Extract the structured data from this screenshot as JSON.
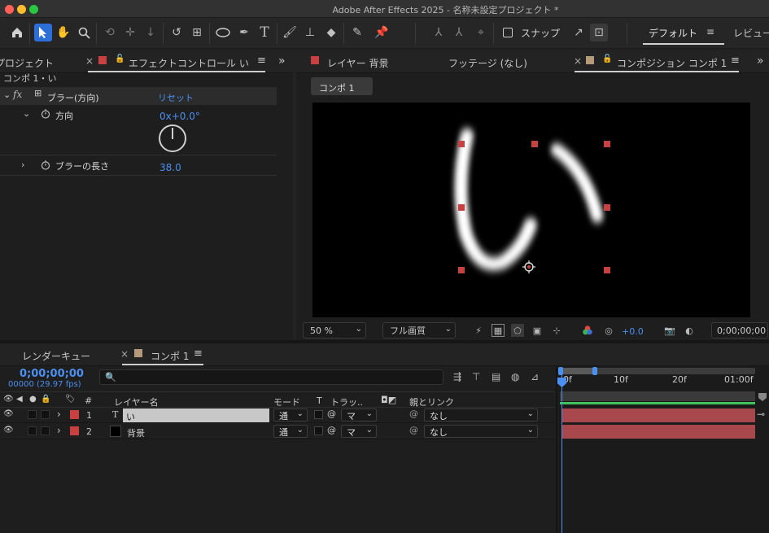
{
  "window": {
    "title": "Adobe After Effects 2025 - 名称未設定プロジェクト *"
  },
  "toolbar": {
    "snap_label": "スナップ",
    "workspace_default": "デフォルト",
    "workspace_review": "レビュー",
    "menu_icon": "≡"
  },
  "effects_panel": {
    "project_tab": "プロジェクト",
    "tab_label": "エフェクトコントロール い",
    "breadcrumb": "コンポ 1・い",
    "effect_name": "ブラー(方向)",
    "reset_label": "リセット",
    "direction_label": "方向",
    "direction_value": "0x+0.0°",
    "blur_length_label": "ブラーの長さ",
    "blur_length_value": "38.0"
  },
  "viewer": {
    "layer_tab": "レイヤー 背景",
    "footage_tab": "フッテージ (なし)",
    "comp_tab": "コンポジション コンポ 1",
    "comp_button": "コンポ 1",
    "text_glyph": "い",
    "zoom": "50 %",
    "quality": "フル画質",
    "exposure": "+0.0",
    "timecode": "0;00;00;00"
  },
  "timeline": {
    "render_queue_tab": "レンダーキュー",
    "comp_tab": "コンポ 1",
    "timecode": "0;00;00;00",
    "frame_info": "00000 (29.97 fps)",
    "search_placeholder": "",
    "columns": {
      "number": "#",
      "layer_name": "レイヤー名",
      "mode": "モード",
      "t": "T",
      "track": "トラッ..",
      "parent": "親とリンク"
    },
    "ruler": [
      "0f",
      "10f",
      "20f",
      "01:00f"
    ],
    "layers": [
      {
        "index": "1",
        "name": "い",
        "type_icon": "T",
        "mode": "通",
        "track": "マ",
        "parent": "なし"
      },
      {
        "index": "2",
        "name": "背景",
        "type_icon": "",
        "mode": "通",
        "track": "マ",
        "parent": "なし"
      }
    ]
  },
  "colors": {
    "accent": "#2d6fd8",
    "blue_text": "#4b8ff0",
    "label_red": "#c94040",
    "label_tan": "#b49a7a",
    "timebar": "#a8484c",
    "workarea_green": "#3ec45a"
  }
}
